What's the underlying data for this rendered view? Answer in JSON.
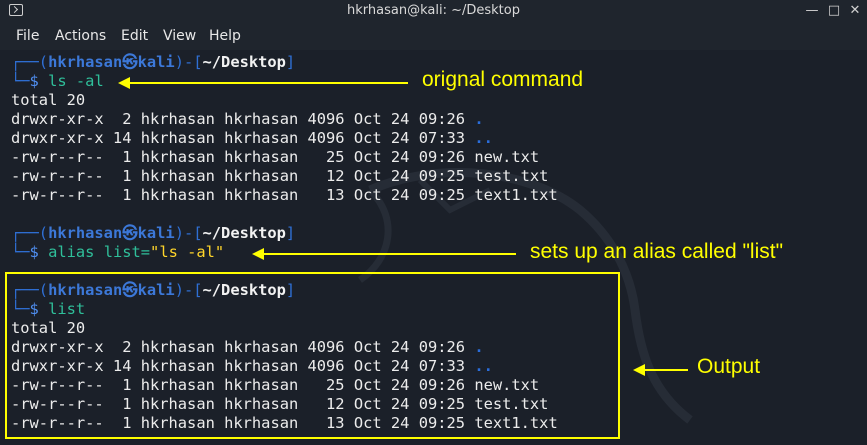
{
  "window": {
    "title": "hkrhasan@kali: ~/Desktop"
  },
  "menu": [
    "File",
    "Actions",
    "Edit",
    "View",
    "Help"
  ],
  "prompt": {
    "open": "┌──(",
    "user": "hkrhasan",
    "at": "㉿",
    "host": "kali",
    "mid": ")-[",
    "path": "~/Desktop",
    "close": "]",
    "corner": "└─",
    "dollar": "$"
  },
  "commands": [
    "ls -al",
    "alias list=",
    "\"ls -al\"",
    "list"
  ],
  "listing": {
    "total": "total 20",
    "rows": [
      {
        "perm": "drwxr-xr-x  2 hkrhasan hkrhasan 4096 Oct 24 09:26 ",
        "name": "."
      },
      {
        "perm": "drwxr-xr-x 14 hkrhasan hkrhasan 4096 Oct 24 07:33 ",
        "name": ".."
      },
      {
        "perm": "-rw-r--r--  1 hkrhasan hkrhasan   25 Oct 24 09:26 ",
        "name": "new.txt"
      },
      {
        "perm": "-rw-r--r--  1 hkrhasan hkrhasan   12 Oct 24 09:25 ",
        "name": "test.txt"
      },
      {
        "perm": "-rw-r--r--  1 hkrhasan hkrhasan   13 Oct 24 09:25 ",
        "name": "text1.txt"
      }
    ]
  },
  "annotations": {
    "a1": "orignal command",
    "a2": "sets up an alias called \"list\"",
    "a3": "Output"
  },
  "colors": {
    "annotation": "#ffff00",
    "background": "#1b2029"
  }
}
